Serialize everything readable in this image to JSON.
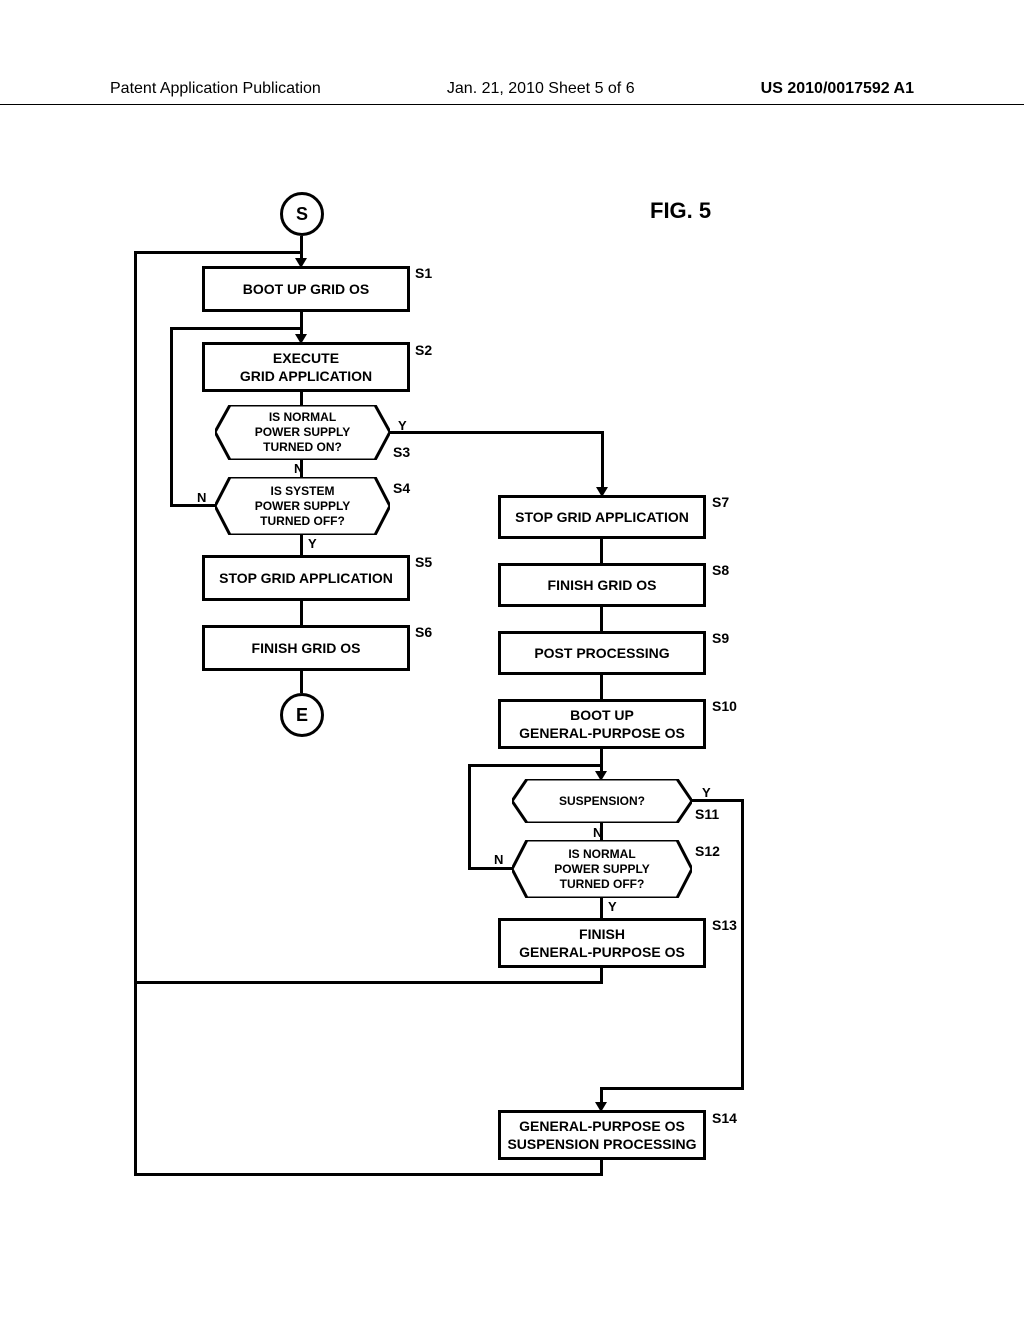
{
  "header": {
    "left": "Patent Application Publication",
    "center": "Jan. 21, 2010   Sheet 5 of 6",
    "right": "US 2010/0017592 A1"
  },
  "figure": {
    "label": "FIG. 5"
  },
  "terminals": {
    "start": "S",
    "end": "E"
  },
  "steps": {
    "s1": {
      "label": "S1",
      "text": "BOOT UP GRID OS"
    },
    "s2": {
      "label": "S2",
      "text": "EXECUTE\nGRID APPLICATION"
    },
    "s3": {
      "label": "S3",
      "text": "IS NORMAL\nPOWER SUPPLY\nTURNED ON?"
    },
    "s4": {
      "label": "S4",
      "text": "IS SYSTEM\nPOWER SUPPLY\nTURNED OFF?"
    },
    "s5": {
      "label": "S5",
      "text": "STOP GRID APPLICATION"
    },
    "s6": {
      "label": "S6",
      "text": "FINISH GRID OS"
    },
    "s7": {
      "label": "S7",
      "text": "STOP GRID APPLICATION"
    },
    "s8": {
      "label": "S8",
      "text": "FINISH GRID OS"
    },
    "s9": {
      "label": "S9",
      "text": "POST PROCESSING"
    },
    "s10": {
      "label": "S10",
      "text": "BOOT UP\nGENERAL-PURPOSE OS"
    },
    "s11": {
      "label": "S11",
      "text": "SUSPENSION?"
    },
    "s12": {
      "label": "S12",
      "text": "IS NORMAL\nPOWER SUPPLY\nTURNED OFF?"
    },
    "s13": {
      "label": "S13",
      "text": "FINISH\nGENERAL-PURPOSE OS"
    },
    "s14": {
      "label": "S14",
      "text": "GENERAL-PURPOSE OS\nSUSPENSION PROCESSING"
    }
  },
  "branches": {
    "y": "Y",
    "n": "N"
  }
}
